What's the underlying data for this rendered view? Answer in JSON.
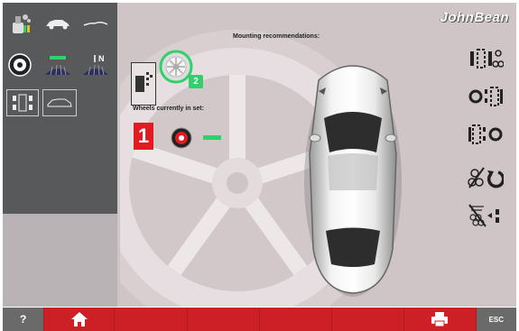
{
  "brand": "JohnBean",
  "main": {
    "mounting_title": "Mounting recommendations:",
    "wheels_title": "Wheels currently in set:",
    "set_number": "1",
    "selected_count": "2"
  },
  "bottom_bar": {
    "help_label": "?",
    "esc_label": "ESC"
  },
  "colors": {
    "accent_red": "#cc1f26",
    "accent_green": "#2fd16b",
    "panel_dark": "#58595b"
  },
  "icons": {
    "left_panel": [
      "tire-sensor-icon",
      "car-side-icon",
      "car-outline-icon",
      "wheel-icon",
      "tread-green-icon",
      "tread-nitrogen-icon",
      "wheel-position-icon",
      "car-top-icon"
    ],
    "right_panel": [
      "swap-front-rear-icon",
      "swap-left-icon",
      "swap-right-icon",
      "rotate-icon",
      "remove-wheel-icon"
    ],
    "bottom_bar": [
      "help-icon",
      "home-icon",
      "print-icon",
      "esc-icon"
    ]
  }
}
